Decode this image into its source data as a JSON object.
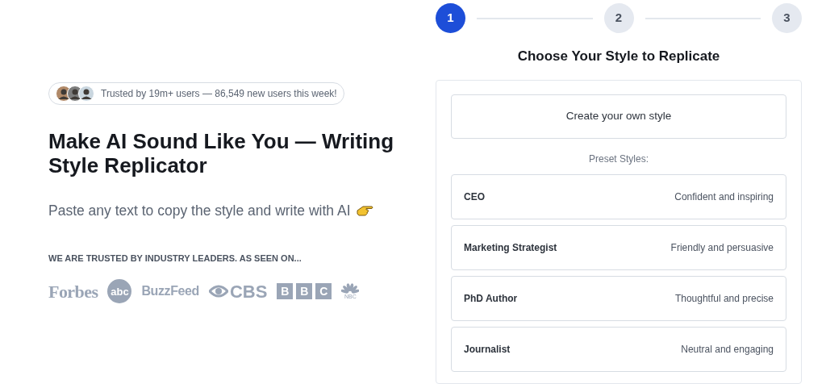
{
  "hero": {
    "badge": {
      "avatars": [
        {
          "color": "#b08968"
        },
        {
          "color": "#7d7d7d"
        },
        {
          "color": "#c9d6df"
        }
      ],
      "text": "Trusted by 19m+ users — 86,549 new users this week!"
    },
    "title": "Make AI Sound Like You — Writing Style Replicator",
    "subtitle": "Paste any text to copy the style and write with AI",
    "trusted_label": "WE ARE TRUSTED BY INDUSTRY LEADERS. AS SEEN ON...",
    "logos": [
      {
        "kind": "serif",
        "text": "Forbes"
      },
      {
        "kind": "circle",
        "text": "abc"
      },
      {
        "kind": "plain",
        "text": "BuzzFeed"
      },
      {
        "kind": "eye",
        "text": "CBS"
      },
      {
        "kind": "blocks",
        "letters": [
          "B",
          "B",
          "C"
        ]
      },
      {
        "kind": "peacock",
        "text": "NBC"
      }
    ]
  },
  "stepper": [
    {
      "label": "1",
      "selected": true
    },
    {
      "label": "2",
      "selected": false
    },
    {
      "label": "3",
      "selected": false
    }
  ],
  "panel": {
    "title": "Choose Your Style to Replicate",
    "create_button": "Create your own style",
    "preset_label": "Preset Styles:",
    "presets": [
      {
        "name": "CEO",
        "description": "Confident and inspiring"
      },
      {
        "name": "Marketing Strategist",
        "description": "Friendly and persuasive"
      },
      {
        "name": "PhD Author",
        "description": "Thoughtful and precise"
      },
      {
        "name": "Journalist",
        "description": "Neutral and engaging"
      }
    ]
  }
}
